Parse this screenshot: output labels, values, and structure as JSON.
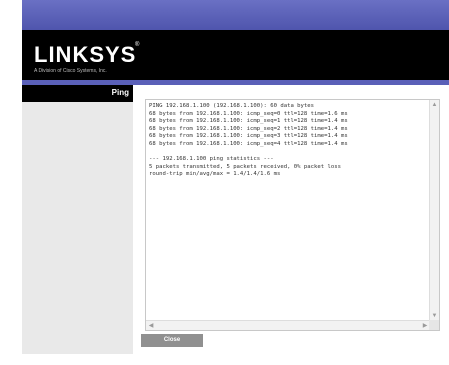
{
  "header": {
    "logo": "LINKSYS",
    "logo_mark": "®",
    "tagline": "A Division of Cisco Systems, Inc."
  },
  "sidebar": {
    "title": "Ping"
  },
  "output": {
    "text": "PING 192.168.1.100 (192.168.1.100): 60 data bytes\n68 bytes from 192.168.1.100: icmp_seq=0 ttl=128 time=1.6 ms\n68 bytes from 192.168.1.100: icmp_seq=1 ttl=128 time=1.4 ms\n68 bytes from 192.168.1.100: icmp_seq=2 ttl=128 time=1.4 ms\n68 bytes from 192.168.1.100: icmp_seq=3 ttl=128 time=1.4 ms\n68 bytes from 192.168.1.100: icmp_seq=4 ttl=128 time=1.4 ms\n\n--- 192.168.1.100 ping statistics ---\n5 packets transmitted, 5 packets received, 0% packet loss\nround-trip min/avg/max = 1.4/1.4/1.6 ms"
  },
  "scroll": {
    "up": "▲",
    "down": "▼",
    "left": "◀",
    "right": "▶"
  },
  "actions": {
    "close_label": "Close"
  },
  "colors": {
    "top_bar": "#5a60b8",
    "header": "#000000",
    "sidebar": "#e9e9e9",
    "button": "#909090"
  }
}
